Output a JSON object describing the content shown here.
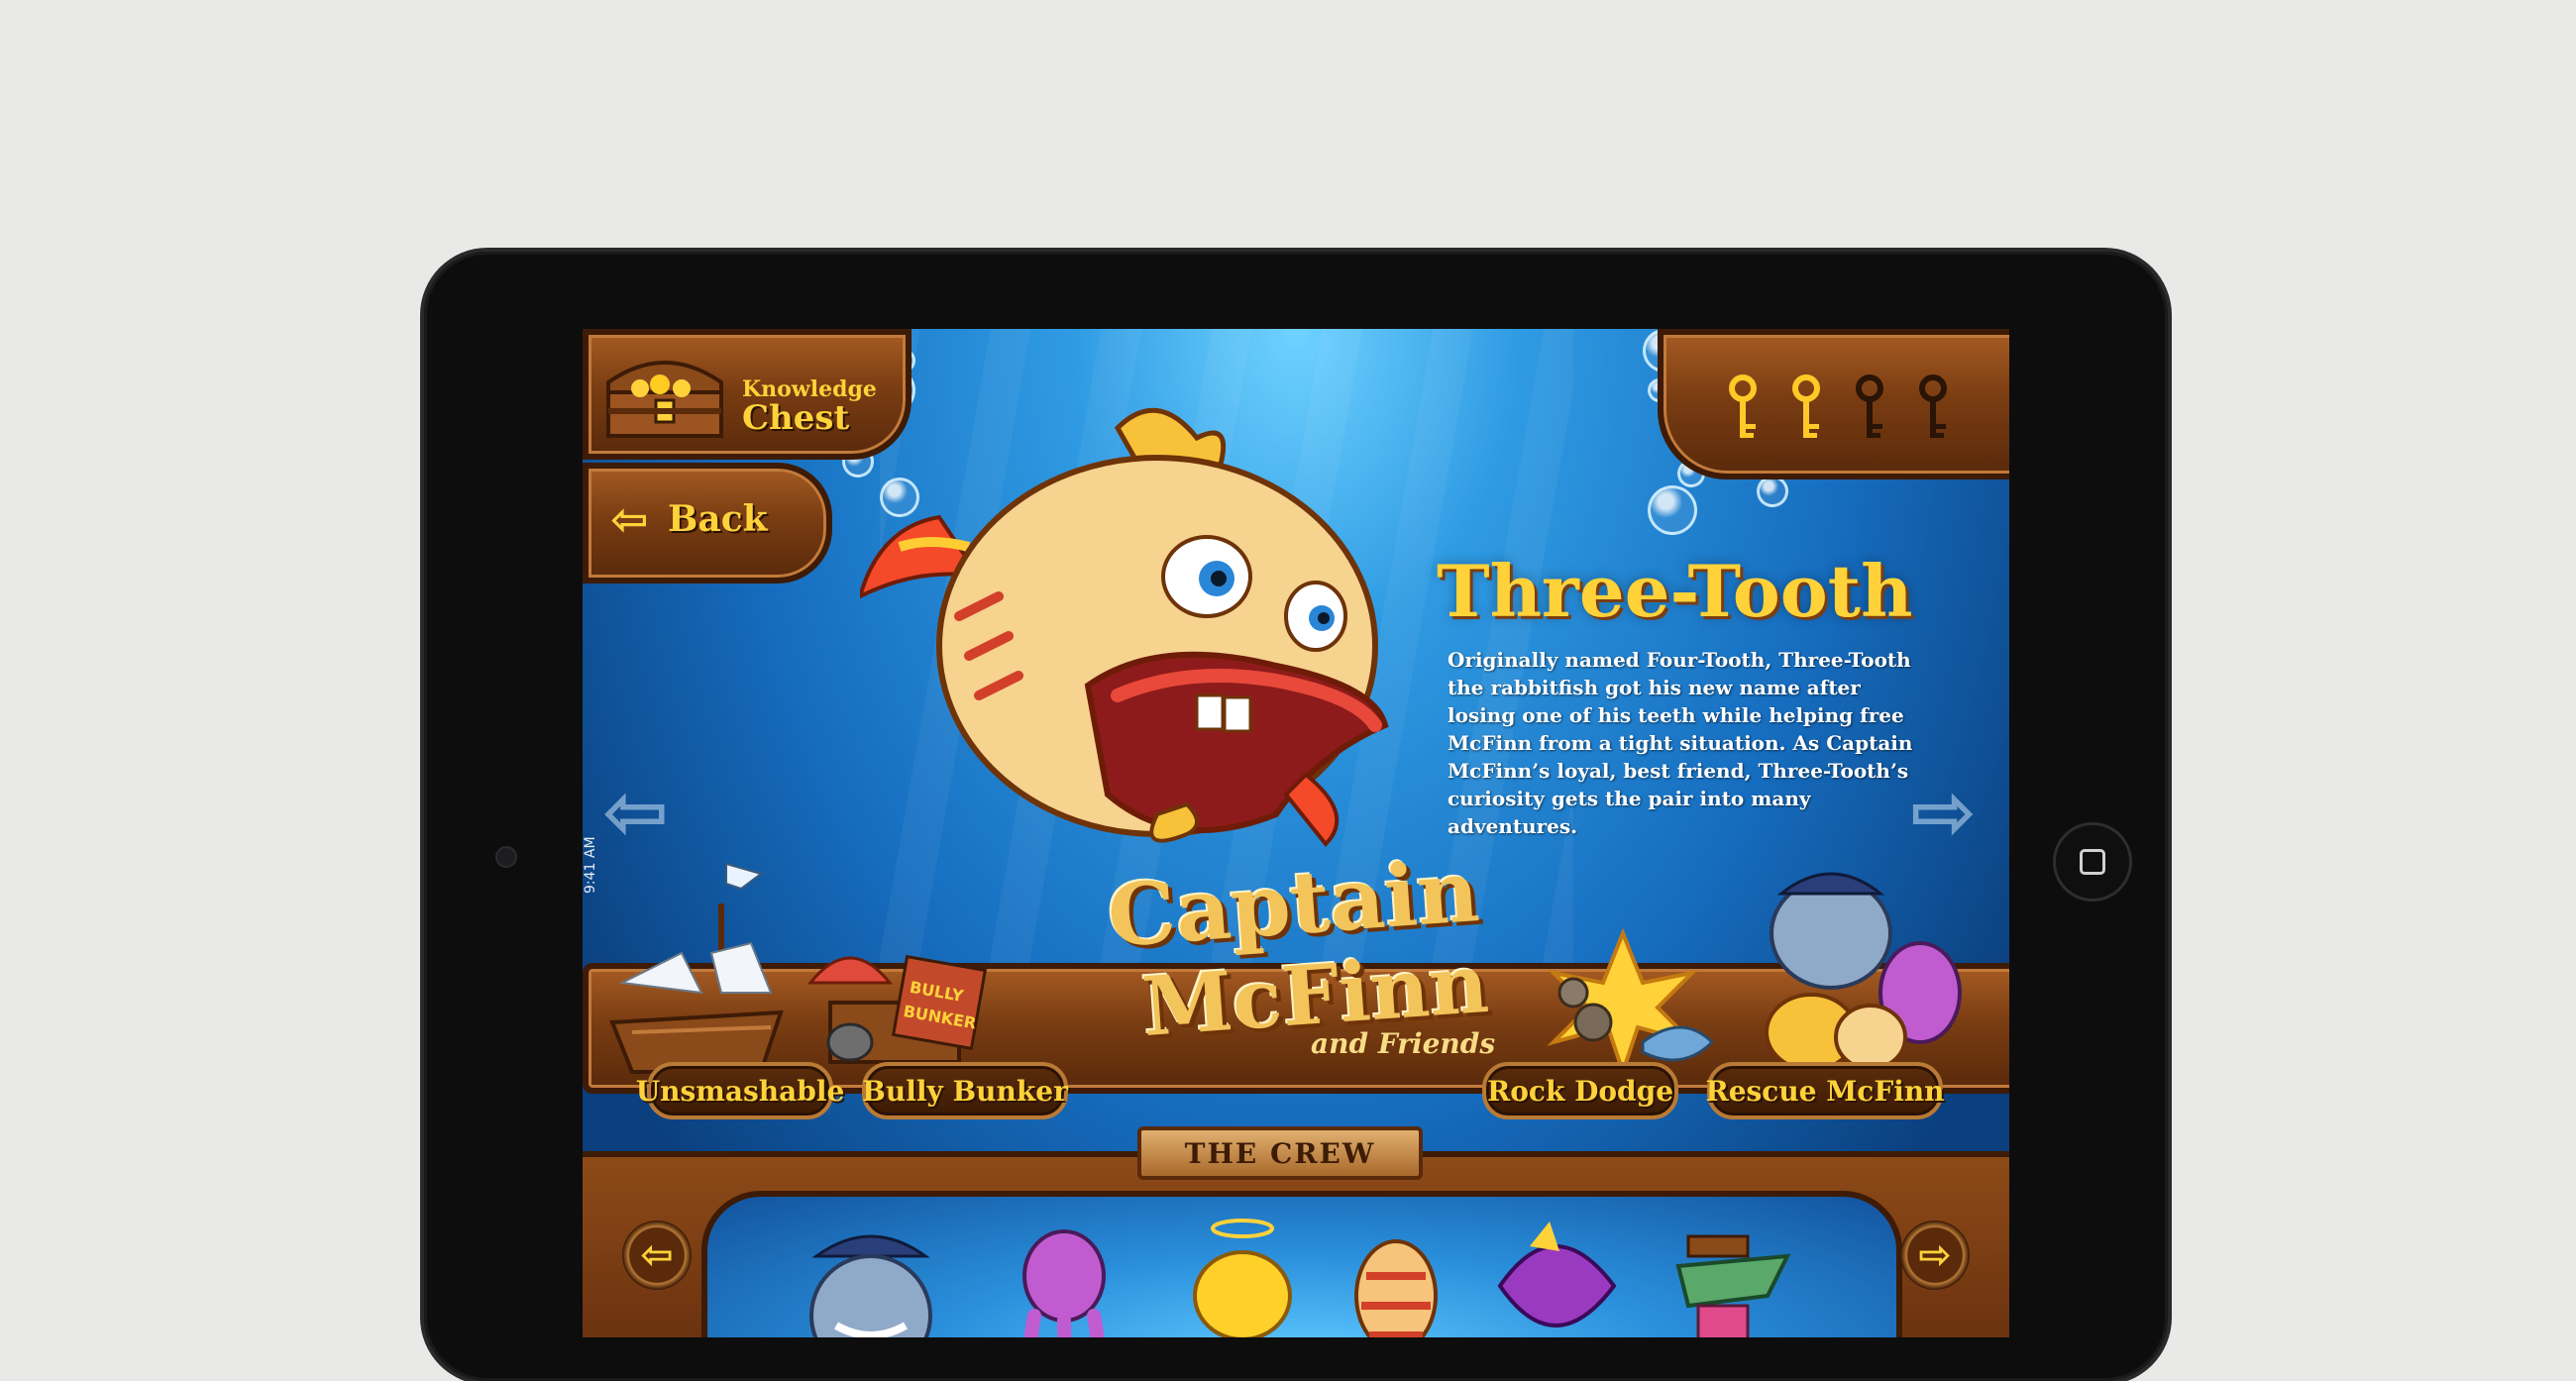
{
  "status_bar": {
    "time": "9:41 AM"
  },
  "knowledge_chest": {
    "line1": "Knowledge",
    "line2": "Chest"
  },
  "back_button": {
    "arrow": "⇦",
    "label": "Back"
  },
  "keys": [
    {
      "collected": true
    },
    {
      "collected": true
    },
    {
      "collected": false
    },
    {
      "collected": false
    }
  ],
  "character": {
    "name": "Three-Tooth",
    "description": "Originally named Four-Tooth, Three-Tooth the rabbitfish got his new name after losing one of his teeth while helping free McFinn from a tight situation. As Captain McFinn’s loyal, best friend, Three-Tooth’s curiosity gets the pair into many adventures."
  },
  "nav": {
    "prev": "⇦",
    "next": "⇨"
  },
  "logo": {
    "line1": "Captain",
    "line2": "McFinn",
    "line3": "and Friends"
  },
  "games": [
    {
      "label": "Unsmashable"
    },
    {
      "label": "Bully Bunker"
    },
    {
      "label": "Rock Dodge"
    },
    {
      "label": "Rescue McFinn"
    }
  ],
  "bunker_sign": {
    "line1": "BULLY",
    "line2": "BUNKER"
  },
  "crew": {
    "title": "THE CREW",
    "prev": "⇦",
    "next": "⇨"
  },
  "colors": {
    "accent": "#ffd23a",
    "wood": "#7a3d12",
    "water": "#166dbf"
  }
}
